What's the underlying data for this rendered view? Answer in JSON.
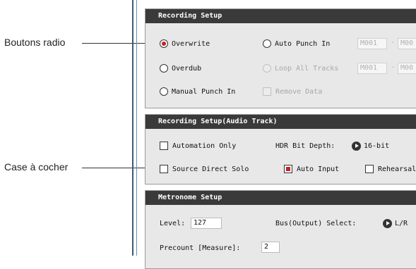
{
  "callouts": {
    "radio_buttons": "Boutons radio",
    "checkbox": "Case à cocher"
  },
  "recording_setup": {
    "title": "Recording Setup",
    "overwrite": "Overwrite",
    "overdub": "Overdub",
    "manual_punch_in": "Manual Punch In",
    "auto_punch_in": "Auto Punch In",
    "loop_all_tracks": "Loop All Tracks",
    "remove_data": "Remove Data",
    "measure_start_1": "M001",
    "measure_end_1": "M00",
    "measure_start_2": "M001",
    "measure_end_2": "M00",
    "dash": "-"
  },
  "audio_track_setup": {
    "title": "Recording Setup(Audio Track)",
    "automation_only": "Automation Only",
    "hdr_bit_depth_label": "HDR Bit Depth:",
    "hdr_bit_depth_value": "16-bit",
    "source_direct_solo": "Source Direct Solo",
    "auto_input": "Auto Input",
    "rehearsal": "Rehearsal"
  },
  "metronome_setup": {
    "title": "Metronome Setup",
    "level_label": "Level:",
    "level_value": "127",
    "bus_label": "Bus(Output) Select:",
    "bus_value": "L/R",
    "precount_label": "Precount [Measure]:",
    "precount_value": "2"
  },
  "state": {
    "mode_selected": "Overwrite",
    "automation_only": false,
    "source_direct_solo": false,
    "auto_input": true,
    "rehearsal": false,
    "remove_data": false
  }
}
